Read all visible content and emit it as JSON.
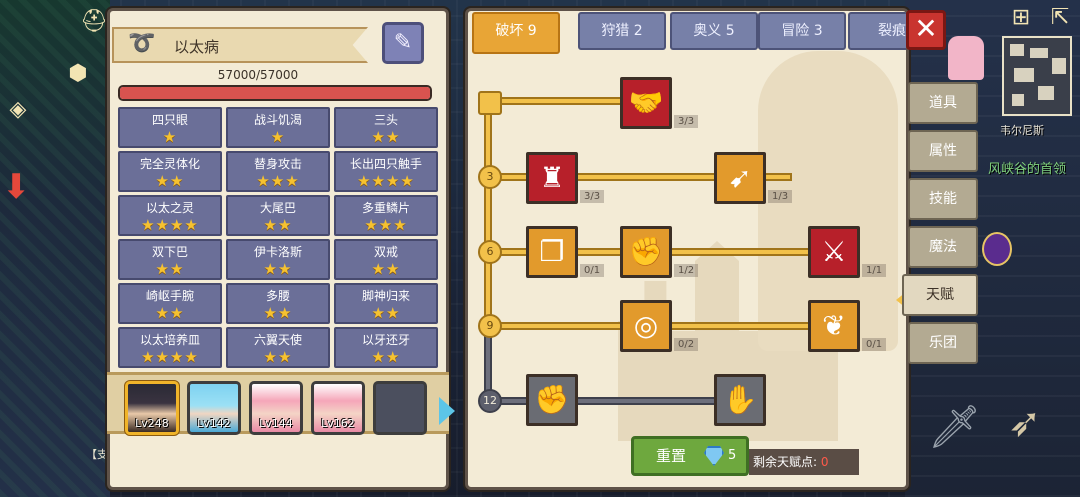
{
  "character": {
    "name": "以太病",
    "hp_text": "57000/57000",
    "hp_fraction": 1.0
  },
  "traits": [
    {
      "name": "四只眼",
      "stars": "★"
    },
    {
      "name": "战斗饥渴",
      "stars": "★"
    },
    {
      "name": "三头",
      "stars": "★★"
    },
    {
      "name": "完全灵体化",
      "stars": "★★"
    },
    {
      "name": "替身攻击",
      "stars": "★★★"
    },
    {
      "name": "长出四只触手",
      "stars": "★★★★"
    },
    {
      "name": "以太之灵",
      "stars": "★★★★"
    },
    {
      "name": "大尾巴",
      "stars": "★★"
    },
    {
      "name": "多重鳞片",
      "stars": "★★★"
    },
    {
      "name": "双下巴",
      "stars": "★★"
    },
    {
      "name": "伊卡洛斯",
      "stars": "★★"
    },
    {
      "name": "双戒",
      "stars": "★★"
    },
    {
      "name": "崎岖手腕",
      "stars": "★★"
    },
    {
      "name": "多腰",
      "stars": "★★"
    },
    {
      "name": "脚神归来",
      "stars": "★★"
    },
    {
      "name": "以太培养皿",
      "stars": "★★★★"
    },
    {
      "name": "六翼天使",
      "stars": "★★"
    },
    {
      "name": "以牙还牙",
      "stars": "★★"
    }
  ],
  "roster": [
    {
      "level": "Lv248",
      "portrait": "hero"
    },
    {
      "level": "Lv142",
      "portrait": "blue"
    },
    {
      "level": "Lv144",
      "portrait": "pink"
    },
    {
      "level": "Lv162",
      "portrait": "pink"
    },
    {
      "level": "",
      "portrait": "empty"
    }
  ],
  "talent_tabs": [
    "破坏 9",
    "狩猎 2",
    "奥义 5",
    "冒险 3",
    "裂痕"
  ],
  "talent_levels": [
    "3",
    "6",
    "9",
    "12"
  ],
  "skills": [
    {
      "id": "arm-wrestle",
      "count": "3/3",
      "color": "red",
      "icon": "handshake-icon"
    },
    {
      "id": "muscle",
      "count": "3/3",
      "color": "red",
      "icon": "muscle-icon"
    },
    {
      "id": "arrow-hit",
      "count": "1/3",
      "color": "orange",
      "icon": "arrow-hit-icon"
    },
    {
      "id": "card-break",
      "count": "0/1",
      "color": "orange",
      "icon": "card-icon"
    },
    {
      "id": "punch",
      "count": "1/2",
      "color": "orange",
      "icon": "punch-icon"
    },
    {
      "id": "slash-blood",
      "count": "1/1",
      "color": "red",
      "icon": "slash-icon"
    },
    {
      "id": "ring-ground",
      "count": "0/2",
      "color": "orange",
      "icon": "ring-icon"
    },
    {
      "id": "bat-wings",
      "count": "0/1",
      "color": "orange",
      "icon": "wings-icon"
    },
    {
      "id": "fist-locked",
      "count": "",
      "color": "grey",
      "icon": "fist-icon"
    },
    {
      "id": "gauntlet-locked",
      "count": "",
      "color": "grey",
      "icon": "gauntlet-icon"
    }
  ],
  "reset": {
    "label": "重置",
    "cost": "5"
  },
  "points": {
    "label": "剩余天赋点:",
    "value": "0"
  },
  "side_tabs": [
    "道具",
    "属性",
    "技能",
    "魔法",
    "天赋",
    "乐团"
  ],
  "active_side_tab": "天赋",
  "world": {
    "map_label": "韦尔尼斯",
    "area_label": "风峡谷的首领",
    "tag_label": "【支"
  },
  "colors": {
    "panel_bg": "#f3ebd6",
    "tab_active": "#e8a536",
    "tab_inactive": "#7780a8",
    "trait_bg": "#6b6f98",
    "star": "#f6c230",
    "hp": "#d8534f"
  }
}
